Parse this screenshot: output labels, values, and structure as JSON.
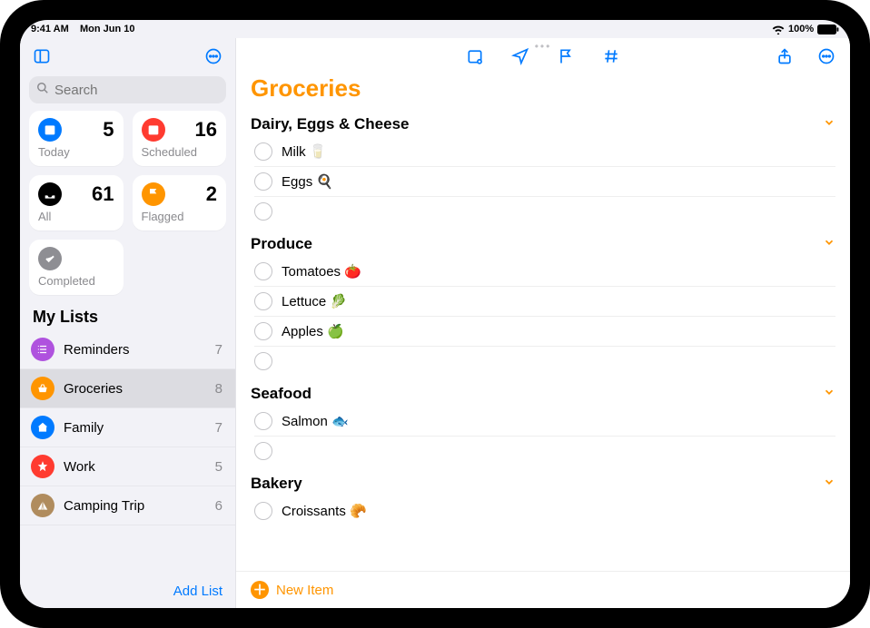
{
  "status": {
    "time": "9:41 AM",
    "date": "Mon Jun 10",
    "battery": "100%"
  },
  "search": {
    "placeholder": "Search"
  },
  "smart": {
    "today": {
      "label": "Today",
      "count": "5",
      "color": "#007aff"
    },
    "scheduled": {
      "label": "Scheduled",
      "count": "16",
      "color": "#ff3b30"
    },
    "all": {
      "label": "All",
      "count": "61",
      "color": "#000000"
    },
    "flagged": {
      "label": "Flagged",
      "count": "2",
      "color": "#ff9500"
    },
    "completed": {
      "label": "Completed",
      "color": "#8e8e93"
    }
  },
  "mylists_title": "My Lists",
  "lists": [
    {
      "name": "Reminders",
      "count": "7",
      "color": "#af52de",
      "icon": "list"
    },
    {
      "name": "Groceries",
      "count": "8",
      "color": "#ff9500",
      "icon": "basket",
      "selected": true
    },
    {
      "name": "Family",
      "count": "7",
      "color": "#007aff",
      "icon": "home"
    },
    {
      "name": "Work",
      "count": "5",
      "color": "#ff3b30",
      "icon": "star"
    },
    {
      "name": "Camping Trip",
      "count": "6",
      "color": "#b08c5e",
      "icon": "tent"
    }
  ],
  "add_list": "Add List",
  "main": {
    "title": "Groceries",
    "accent": "#ff9500",
    "new_item": "New Item",
    "sections": [
      {
        "title": "Dairy, Eggs & Cheese",
        "items": [
          "Milk 🥛",
          "Eggs 🍳",
          ""
        ]
      },
      {
        "title": "Produce",
        "items": [
          "Tomatoes 🍅",
          "Lettuce 🥬",
          "Apples 🍏",
          ""
        ]
      },
      {
        "title": "Seafood",
        "items": [
          "Salmon 🐟",
          ""
        ]
      },
      {
        "title": "Bakery",
        "items": [
          "Croissants 🥐"
        ]
      }
    ]
  }
}
